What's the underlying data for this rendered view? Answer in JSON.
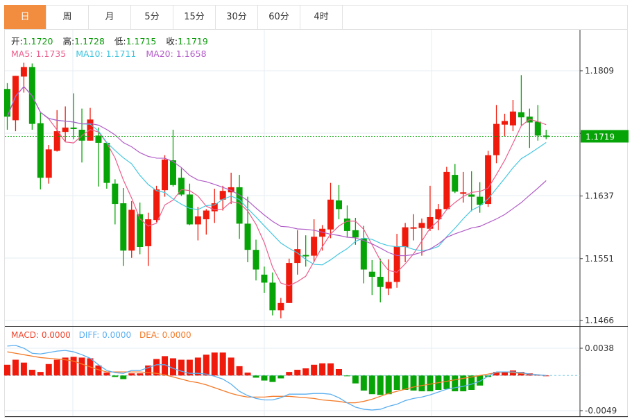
{
  "tabs": [
    {
      "label": "日",
      "active": true
    },
    {
      "label": "周",
      "active": false
    },
    {
      "label": "月",
      "active": false
    },
    {
      "label": "5分",
      "active": false
    },
    {
      "label": "15分",
      "active": false
    },
    {
      "label": "30分",
      "active": false
    },
    {
      "label": "60分",
      "active": false
    },
    {
      "label": "4时",
      "active": false
    }
  ],
  "info": {
    "open_label": "开:",
    "open": "1.1720",
    "high_label": "高:",
    "high": "1.1728",
    "low_label": "低:",
    "low": "1.1715",
    "close_label": "收:",
    "close": "1.1719",
    "ma5": "MA5: 1.1735",
    "ma10": "MA10: 1.1711",
    "ma20": "MA20: 1.1658"
  },
  "macd_info": {
    "macd": "MACD: 0.0000",
    "diff": "DIFF: 0.0000",
    "dea": "DEA: 0.0000"
  },
  "colors": {
    "up": "#f01a0c",
    "down": "#06a406",
    "ma5": "#ec5d8b",
    "ma10": "#45c7e0",
    "ma20": "#b15cc7",
    "diff": "#5aaef0",
    "dea": "#f47a28",
    "active_tab": "#f28c3e",
    "last_price_bg": "#06a406"
  },
  "chart_data": {
    "type": "candlestick",
    "price_ticks": [
      "1.1809",
      "1.1723",
      "1.1637",
      "1.1551",
      "1.1466"
    ],
    "ylim": [
      1.1466,
      1.1809
    ],
    "last_price": "1.1719",
    "candles": [
      [
        1.1784,
        1.1792,
        1.1728,
        1.1746
      ],
      [
        1.1741,
        1.1802,
        1.1726,
        1.1802
      ],
      [
        1.1801,
        1.182,
        1.1779,
        1.1814
      ],
      [
        1.1814,
        1.1819,
        1.1728,
        1.1736
      ],
      [
        1.1737,
        1.1752,
        1.1646,
        1.1662
      ],
      [
        1.1662,
        1.1707,
        1.1654,
        1.1701
      ],
      [
        1.1699,
        1.1755,
        1.1698,
        1.1726
      ],
      [
        1.1725,
        1.176,
        1.1712,
        1.1731
      ],
      [
        1.1731,
        1.1778,
        1.1715,
        1.1729
      ],
      [
        1.1728,
        1.1757,
        1.1683,
        1.1713
      ],
      [
        1.1713,
        1.1758,
        1.1713,
        1.1742
      ],
      [
        1.172,
        1.1731,
        1.165,
        1.171
      ],
      [
        1.171,
        1.171,
        1.1647,
        1.1655
      ],
      [
        1.1654,
        1.166,
        1.1598,
        1.1626
      ],
      [
        1.1627,
        1.1648,
        1.1541,
        1.1562
      ],
      [
        1.1562,
        1.163,
        1.1552,
        1.1618
      ],
      [
        1.1612,
        1.1628,
        1.1557,
        1.1567
      ],
      [
        1.1568,
        1.1614,
        1.1541,
        1.1605
      ],
      [
        1.1604,
        1.1651,
        1.1601,
        1.1646
      ],
      [
        1.1645,
        1.1693,
        1.1636,
        1.1687
      ],
      [
        1.1686,
        1.1728,
        1.165,
        1.1652
      ],
      [
        1.1662,
        1.1675,
        1.1637,
        1.1639
      ],
      [
        1.1639,
        1.1654,
        1.1597,
        1.1598
      ],
      [
        1.1598,
        1.1622,
        1.1576,
        1.1609
      ],
      [
        1.1605,
        1.1619,
        1.1584,
        1.1617
      ],
      [
        1.1616,
        1.1647,
        1.16,
        1.1627
      ],
      [
        1.1632,
        1.1651,
        1.1617,
        1.1644
      ],
      [
        1.1642,
        1.1669,
        1.1626,
        1.1649
      ],
      [
        1.1649,
        1.1666,
        1.1578,
        1.1599
      ],
      [
        1.1599,
        1.1636,
        1.1546,
        1.1563
      ],
      [
        1.1563,
        1.1577,
        1.1521,
        1.1536
      ],
      [
        1.1529,
        1.154,
        1.1504,
        1.1518
      ],
      [
        1.1518,
        1.1532,
        1.1473,
        1.148
      ],
      [
        1.148,
        1.1497,
        1.1469,
        1.149
      ],
      [
        1.149,
        1.1551,
        1.149,
        1.1545
      ],
      [
        1.1545,
        1.159,
        1.1529,
        1.1564
      ],
      [
        1.1556,
        1.1583,
        1.154,
        1.1555
      ],
      [
        1.1555,
        1.1605,
        1.1546,
        1.1581
      ],
      [
        1.1581,
        1.1597,
        1.1562,
        1.1592
      ],
      [
        1.1591,
        1.1655,
        1.1579,
        1.1632
      ],
      [
        1.1631,
        1.1652,
        1.1605,
        1.1619
      ],
      [
        1.1606,
        1.1624,
        1.158,
        1.1589
      ],
      [
        1.159,
        1.1607,
        1.157,
        1.158
      ],
      [
        1.1579,
        1.1596,
        1.1517,
        1.1536
      ],
      [
        1.1533,
        1.1549,
        1.1501,
        1.1526
      ],
      [
        1.1526,
        1.1551,
        1.1491,
        1.1512
      ],
      [
        1.151,
        1.155,
        1.1501,
        1.1519
      ],
      [
        1.1519,
        1.1585,
        1.1511,
        1.1568
      ],
      [
        1.1567,
        1.16,
        1.1546,
        1.1594
      ],
      [
        1.1593,
        1.1612,
        1.1576,
        1.1594
      ],
      [
        1.1593,
        1.1606,
        1.1555,
        1.16
      ],
      [
        1.1592,
        1.1651,
        1.1589,
        1.1608
      ],
      [
        1.1605,
        1.1626,
        1.159,
        1.1619
      ],
      [
        1.1619,
        1.1677,
        1.1619,
        1.167
      ],
      [
        1.1666,
        1.1681,
        1.1641,
        1.1643
      ],
      [
        1.164,
        1.167,
        1.1628,
        1.1642
      ],
      [
        1.1639,
        1.1671,
        1.1616,
        1.1636
      ],
      [
        1.1636,
        1.1656,
        1.1614,
        1.1625
      ],
      [
        1.1626,
        1.1699,
        1.1622,
        1.1693
      ],
      [
        1.1693,
        1.1762,
        1.1682,
        1.1736
      ],
      [
        1.1735,
        1.175,
        1.1719,
        1.174
      ],
      [
        1.1734,
        1.1769,
        1.1726,
        1.1753
      ],
      [
        1.1752,
        1.1803,
        1.1734,
        1.1745
      ],
      [
        1.1746,
        1.1757,
        1.1703,
        1.1738
      ],
      [
        1.1739,
        1.1762,
        1.1713,
        1.172
      ],
      [
        1.172,
        1.1728,
        1.1715,
        1.1719
      ]
    ],
    "macd_ticks": [
      "0.0038",
      "-0.0049"
    ],
    "macd_ylim": [
      -0.0049,
      0.0038
    ],
    "macd_hist": [
      0.0015,
      0.0022,
      0.0018,
      0.0008,
      0.0005,
      0.0016,
      0.0022,
      0.0025,
      0.0026,
      0.0025,
      0.0024,
      0.0014,
      0.0004,
      -0.0002,
      -0.0005,
      0.0003,
      0.0003,
      0.0014,
      0.0023,
      0.0027,
      0.0024,
      0.0022,
      0.0022,
      0.0025,
      0.0029,
      0.0032,
      0.0032,
      0.0025,
      0.0013,
      0.0004,
      -0.0003,
      -0.0007,
      -0.0009,
      -0.0004,
      0.0005,
      0.0008,
      0.001,
      0.0015,
      0.0017,
      0.0017,
      0.0009,
      -0.0001,
      -0.0011,
      -0.0021,
      -0.0026,
      -0.0027,
      -0.0026,
      -0.002,
      -0.002,
      -0.0021,
      -0.0022,
      -0.0022,
      -0.002,
      -0.0019,
      -0.0022,
      -0.0022,
      -0.002,
      -0.0014,
      -0.0002,
      0.0005,
      0.0005,
      0.0007,
      0.0005,
      0.0003,
      0.0001,
      0.0
    ],
    "diff": [
      0.0041,
      0.0042,
      0.0038,
      0.0031,
      0.003,
      0.0032,
      0.0034,
      0.0035,
      0.0033,
      0.0029,
      0.0024,
      0.0015,
      0.0007,
      0.0004,
      0.0003,
      0.0007,
      0.0007,
      0.0011,
      0.0015,
      0.0015,
      0.001,
      0.0006,
      0.0003,
      0.0003,
      0.0002,
      -0.0001,
      -0.0005,
      -0.0012,
      -0.0022,
      -0.0028,
      -0.0032,
      -0.0034,
      -0.0034,
      -0.0031,
      -0.0026,
      -0.0026,
      -0.0026,
      -0.0025,
      -0.0025,
      -0.0026,
      -0.0031,
      -0.0038,
      -0.0044,
      -0.0047,
      -0.0048,
      -0.0047,
      -0.0043,
      -0.004,
      -0.0035,
      -0.0032,
      -0.003,
      -0.0027,
      -0.0023,
      -0.0019,
      -0.0017,
      -0.0015,
      -0.0012,
      -0.0008,
      -0.0001,
      0.0005,
      0.0005,
      0.0005,
      0.0004,
      0.0002,
      0.0001,
      0.0
    ],
    "dea": [
      0.0033,
      0.0031,
      0.0029,
      0.0027,
      0.0025,
      0.0024,
      0.0023,
      0.0022,
      0.002,
      0.0016,
      0.0012,
      0.0008,
      0.0005,
      0.0005,
      0.0005,
      0.0005,
      0.0005,
      0.0004,
      0.0003,
      0.0001,
      -0.0002,
      -0.0005,
      -0.0008,
      -0.001,
      -0.0013,
      -0.0017,
      -0.0021,
      -0.0025,
      -0.0028,
      -0.003,
      -0.003,
      -0.003,
      -0.0029,
      -0.0029,
      -0.0029,
      -0.003,
      -0.0031,
      -0.0032,
      -0.0034,
      -0.0035,
      -0.0036,
      -0.0038,
      -0.0038,
      -0.0036,
      -0.0033,
      -0.0029,
      -0.0025,
      -0.0022,
      -0.0019,
      -0.0016,
      -0.0014,
      -0.0012,
      -0.001,
      -0.0008,
      -0.0006,
      -0.0004,
      -0.0002,
      0.0,
      0.0002,
      0.0004,
      0.0005,
      0.0004,
      0.0003,
      0.0002,
      0.0001,
      0.0
    ]
  }
}
